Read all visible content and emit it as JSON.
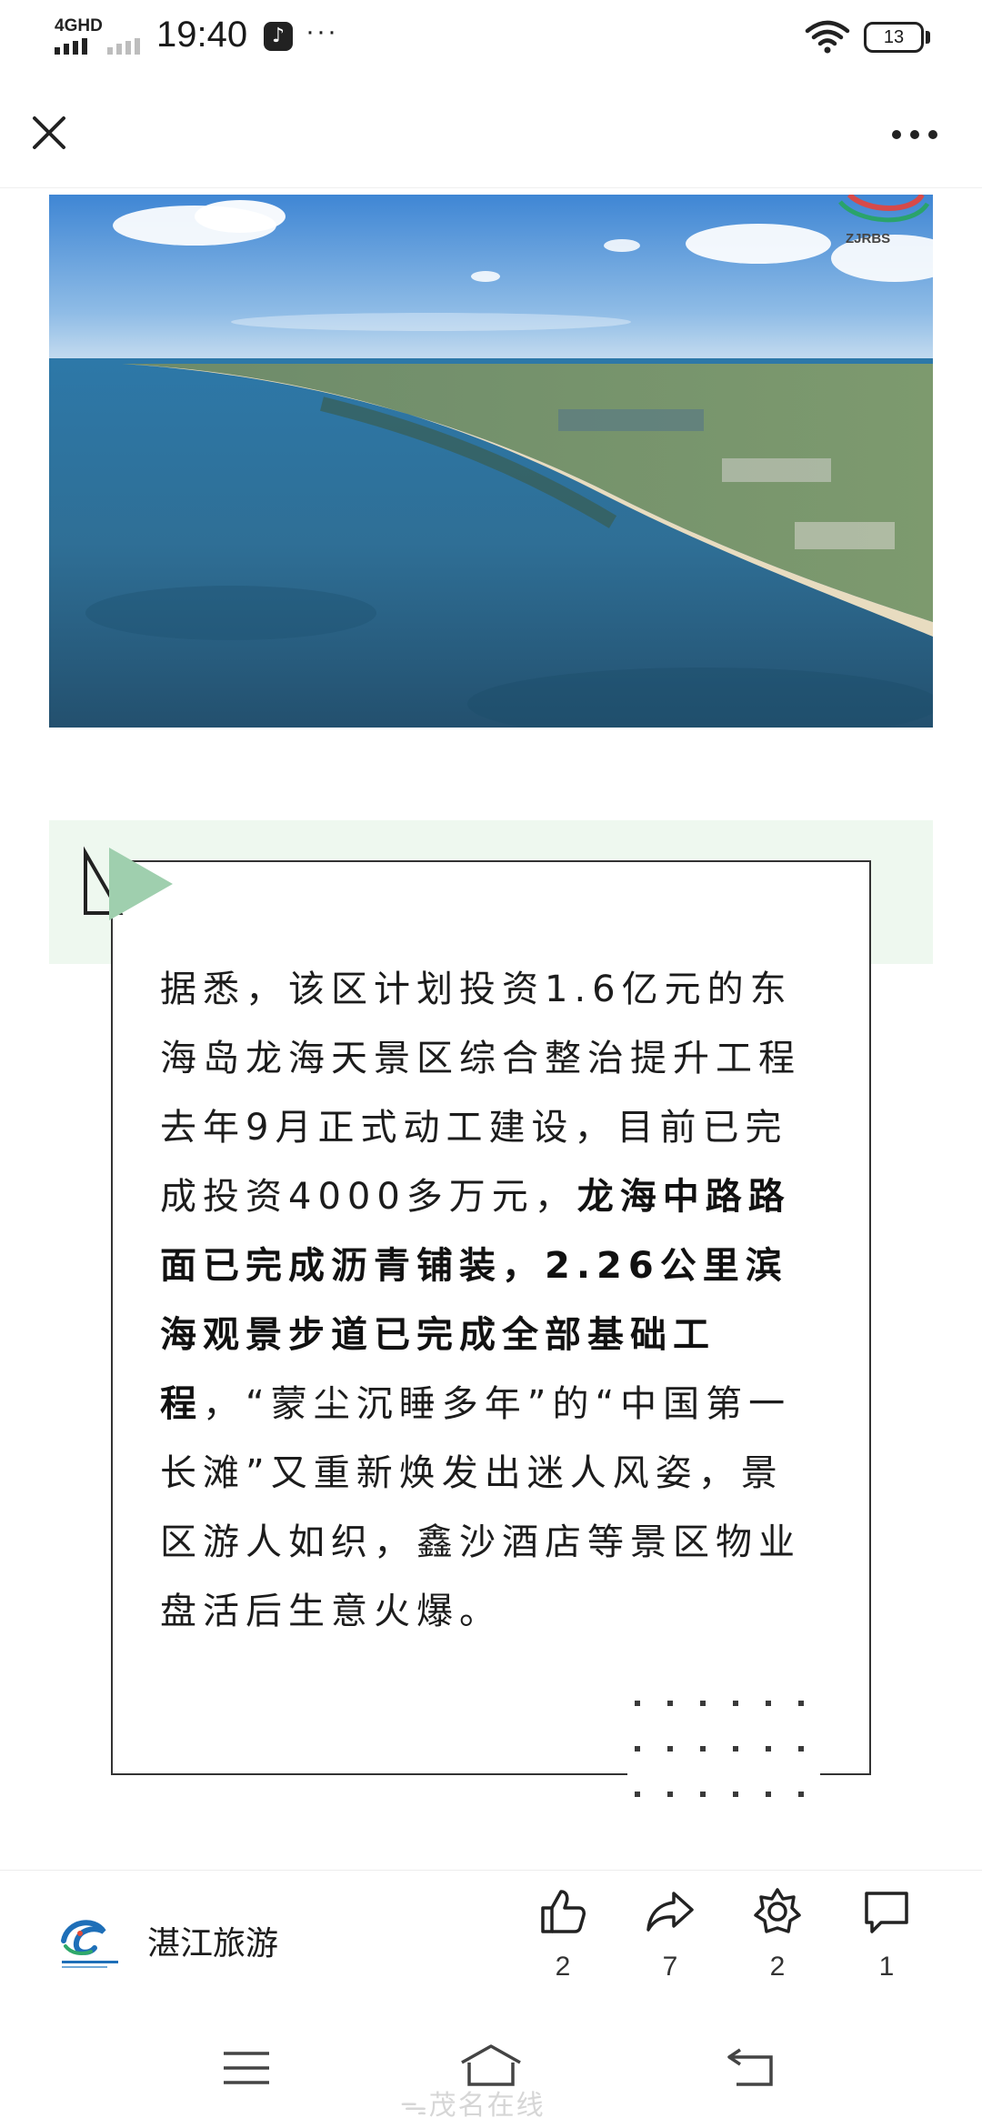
{
  "status_bar": {
    "network": "4GHD",
    "time": "19:40",
    "more": "···",
    "battery": "13"
  },
  "header": {
    "close_icon": "close-icon",
    "menu_icon": "more-horizontal-icon"
  },
  "photo": {
    "watermark": "ZJRBS"
  },
  "article": {
    "p1": "据悉，该区计划投资1.6亿元的东海岛龙海天景区综合整治提升工程去年9月正式动工建设，目前已完成投资4000多万元，",
    "bold": "龙海中路路面已完成沥青铺装，2.26公里滨海观景步道已完成全部基础工程",
    "p2": "，“蒙尘沉睡多年”的“中国第一长滩”又重新焕发出迷人风姿，景区游人如织，鑫沙酒店等景区物业盘活后生意火爆。"
  },
  "bottom_bar": {
    "account_name": "湛江旅游",
    "actions": [
      {
        "icon": "thumbs-up-icon",
        "count": "2"
      },
      {
        "icon": "share-icon",
        "count": "7"
      },
      {
        "icon": "favorite-icon",
        "count": "2"
      },
      {
        "icon": "comment-icon",
        "count": "1"
      }
    ]
  },
  "system_nav": {
    "watermark": "ᯓ茂名在线"
  },
  "colors": {
    "accent_green": "#9fcfae",
    "band_green": "#eef8ef",
    "text": "#1c1c1c"
  }
}
